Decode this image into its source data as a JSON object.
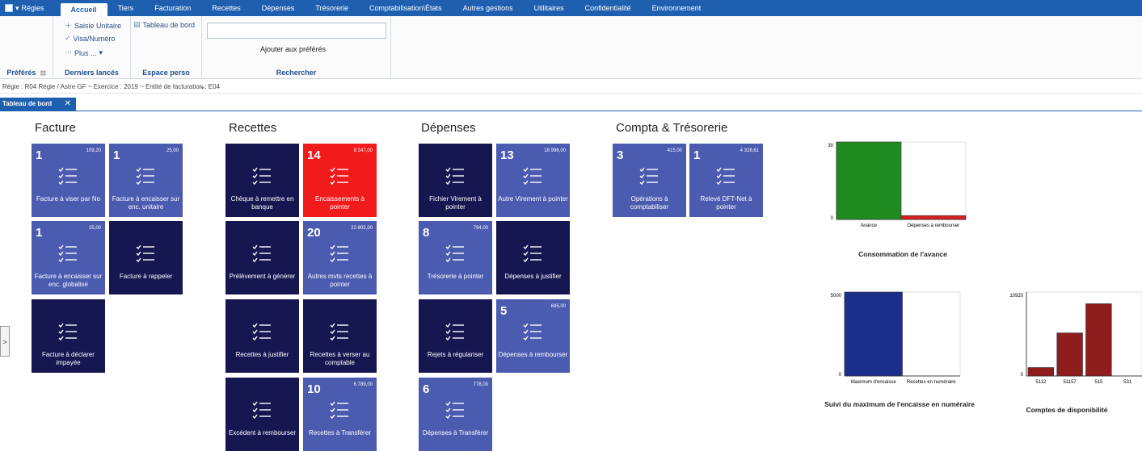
{
  "menubar": {
    "app_label": "Régies",
    "tabs": [
      "Accueil",
      "Tiers",
      "Facturation",
      "Recettes",
      "Dépenses",
      "Trésorerie",
      "Comptabilisation\\États",
      "Autres gestions",
      "Utilitaires",
      "Confidentialité",
      "Environnement"
    ],
    "active_tab": "Accueil"
  },
  "ribbon": {
    "preferes_label": "Préférés",
    "derniers": [
      "Saisie Unitaire",
      "Visa/Numéro",
      "Plus ..."
    ],
    "derniers_label": "Derniers lancés",
    "espace_item": "Tableau de bord",
    "espace_label": "Espace perso",
    "search_value": "",
    "add_fav": "Ajouter aux préférés",
    "rechercher_label": "Rechercher"
  },
  "breadcrumb": "Régie : R04 Régie / Astre GF ~ Exercice : 2019 ~ Entité de facturation : E04",
  "doc_tab": {
    "label": "Tableau de bord",
    "close": "✕"
  },
  "sidebar_toggle": ">",
  "sections": [
    {
      "title": "Facture",
      "tiles": [
        {
          "count": "1",
          "amount": "109,20",
          "label": "Facture à viser par No",
          "style": "blue"
        },
        {
          "count": "1",
          "amount": "25,00",
          "label": "Facture à encaisser sur enc. unitaire",
          "style": "blue"
        },
        {
          "count": "1",
          "amount": "25,00",
          "label": "Facture à encaisser sur enc. globalisé",
          "style": "blue"
        },
        {
          "count": "",
          "amount": "",
          "label": "Facture à rappeler",
          "style": "dark"
        },
        {
          "count": "",
          "amount": "",
          "label": "Facture à déclarer impayée",
          "style": "dark"
        }
      ]
    },
    {
      "title": "Recettes",
      "tiles": [
        {
          "count": "",
          "amount": "",
          "label": "Chèque à remettre en banque",
          "style": "dark"
        },
        {
          "count": "14",
          "amount": "8 347,00",
          "label": "Encaissements à pointer",
          "style": "red"
        },
        {
          "count": "",
          "amount": "",
          "label": "Prélèvement à générer",
          "style": "dark"
        },
        {
          "count": "20",
          "amount": "22 802,00",
          "label": "Autres mvts recettes à pointer",
          "style": "blue"
        },
        {
          "count": "",
          "amount": "",
          "label": "Recettes à justifier",
          "style": "dark"
        },
        {
          "count": "",
          "amount": "",
          "label": "Recettes à verser au comptable",
          "style": "dark"
        },
        {
          "count": "",
          "amount": "",
          "label": "Excédent à rembourser",
          "style": "dark"
        },
        {
          "count": "10",
          "amount": "6 789,00",
          "label": "Recettes à Transférer",
          "style": "blue"
        }
      ]
    },
    {
      "title": "Dépenses",
      "tiles": [
        {
          "count": "",
          "amount": "",
          "label": "Fichier Virement à pointer",
          "style": "dark"
        },
        {
          "count": "13",
          "amount": "18 996,00",
          "label": "Autre Virement à pointer",
          "style": "blue"
        },
        {
          "count": "8",
          "amount": "794,00",
          "label": "Trésorerie à pointer",
          "style": "blue"
        },
        {
          "count": "",
          "amount": "",
          "label": "Dépenses à justifier",
          "style": "dark"
        },
        {
          "count": "",
          "amount": "",
          "label": "Rejets à régulariser",
          "style": "dark"
        },
        {
          "count": "5",
          "amount": "695,00",
          "label": "Dépenses à rembourser",
          "style": "blue"
        },
        {
          "count": "6",
          "amount": "778,00",
          "label": "Dépenses à Transférer",
          "style": "blue"
        }
      ]
    },
    {
      "title": "Compta & Trésorerie",
      "tiles": [
        {
          "count": "3",
          "amount": "415,00",
          "label": "Opérations à comptabiliser",
          "style": "blue"
        },
        {
          "count": "1",
          "amount": "4 328,61",
          "label": "Relevé DFT-Net à pointer",
          "style": "blue"
        }
      ]
    }
  ],
  "chart_data": [
    {
      "type": "bar",
      "title": "Consommation de l'avance",
      "categories": [
        "Avance",
        "Dépenses à rembourser"
      ],
      "values": [
        30,
        1.5
      ],
      "ylim": [
        0,
        30
      ],
      "yticks": [
        "0",
        "30"
      ],
      "colors": [
        "#1f8a1f",
        "#d42020"
      ]
    },
    {
      "type": "bar",
      "title": "Suivi du maximum de l'encaisse en numéraire",
      "categories": [
        "Maximum d'encaisse",
        "Recettes en numéraire"
      ],
      "values": [
        5000,
        0
      ],
      "ylim": [
        0,
        5000
      ],
      "yticks": [
        "0",
        "5000"
      ],
      "colors": [
        "#1c2f8a",
        "#1c2f8a"
      ]
    },
    {
      "type": "bar",
      "title": "Comptes de disponibilité",
      "categories": [
        "5112",
        "51157",
        "515",
        "531"
      ],
      "values": [
        1100,
        5600,
        9400,
        0
      ],
      "ylim": [
        0,
        10920
      ],
      "yticks": [
        "0",
        "10920"
      ],
      "colors": [
        "#8e1d1d",
        "#8e1d1d",
        "#8e1d1d",
        "#8e1d1d"
      ]
    }
  ]
}
